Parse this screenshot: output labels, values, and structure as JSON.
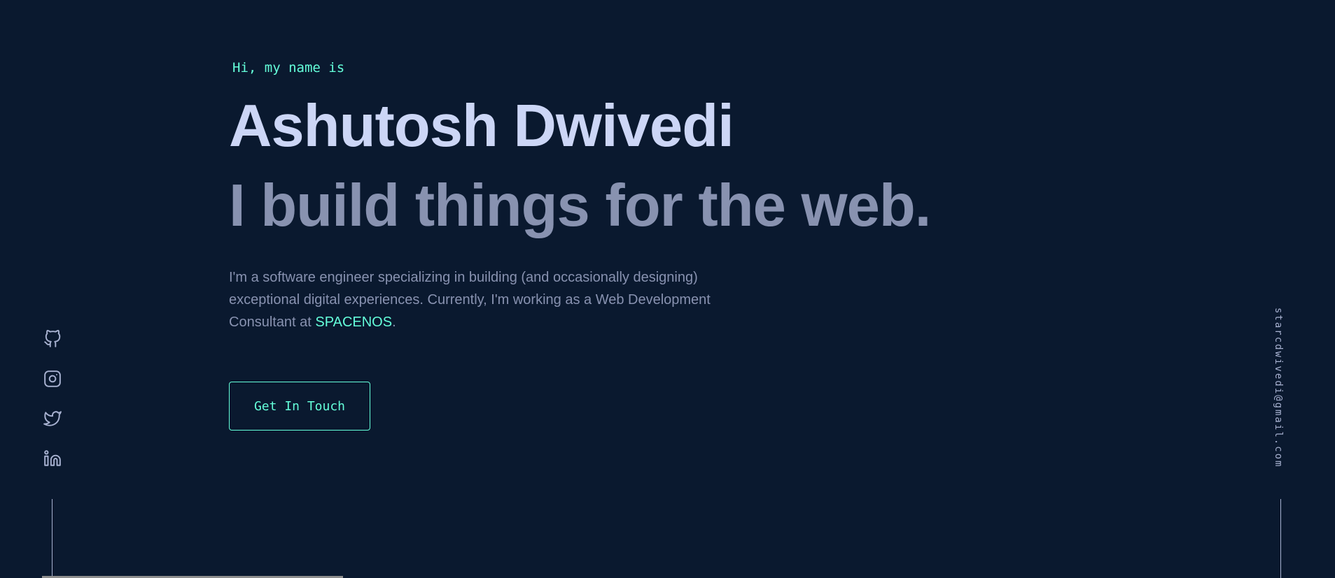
{
  "hero": {
    "greeting": "Hi, my name is",
    "name": "Ashutosh Dwivedi",
    "tagline": "I build things for the web.",
    "intro_text": "I'm a software engineer specializing in building (and occasionally designing) exceptional digital experiences. Currently, I'm working as a Web Development Consultant at ",
    "company": "SPACENOS",
    "intro_end": ".",
    "cta_label": "Get In Touch"
  },
  "social": {
    "icons": [
      "github-icon",
      "instagram-icon",
      "twitter-icon",
      "linkedin-icon"
    ]
  },
  "email": "starcdwivedi@gmail.com",
  "colors": {
    "background": "#0a192f",
    "accent": "#64ffda",
    "heading": "#ccd6f6",
    "text": "#8892b0",
    "icon": "#a8b2d1"
  }
}
